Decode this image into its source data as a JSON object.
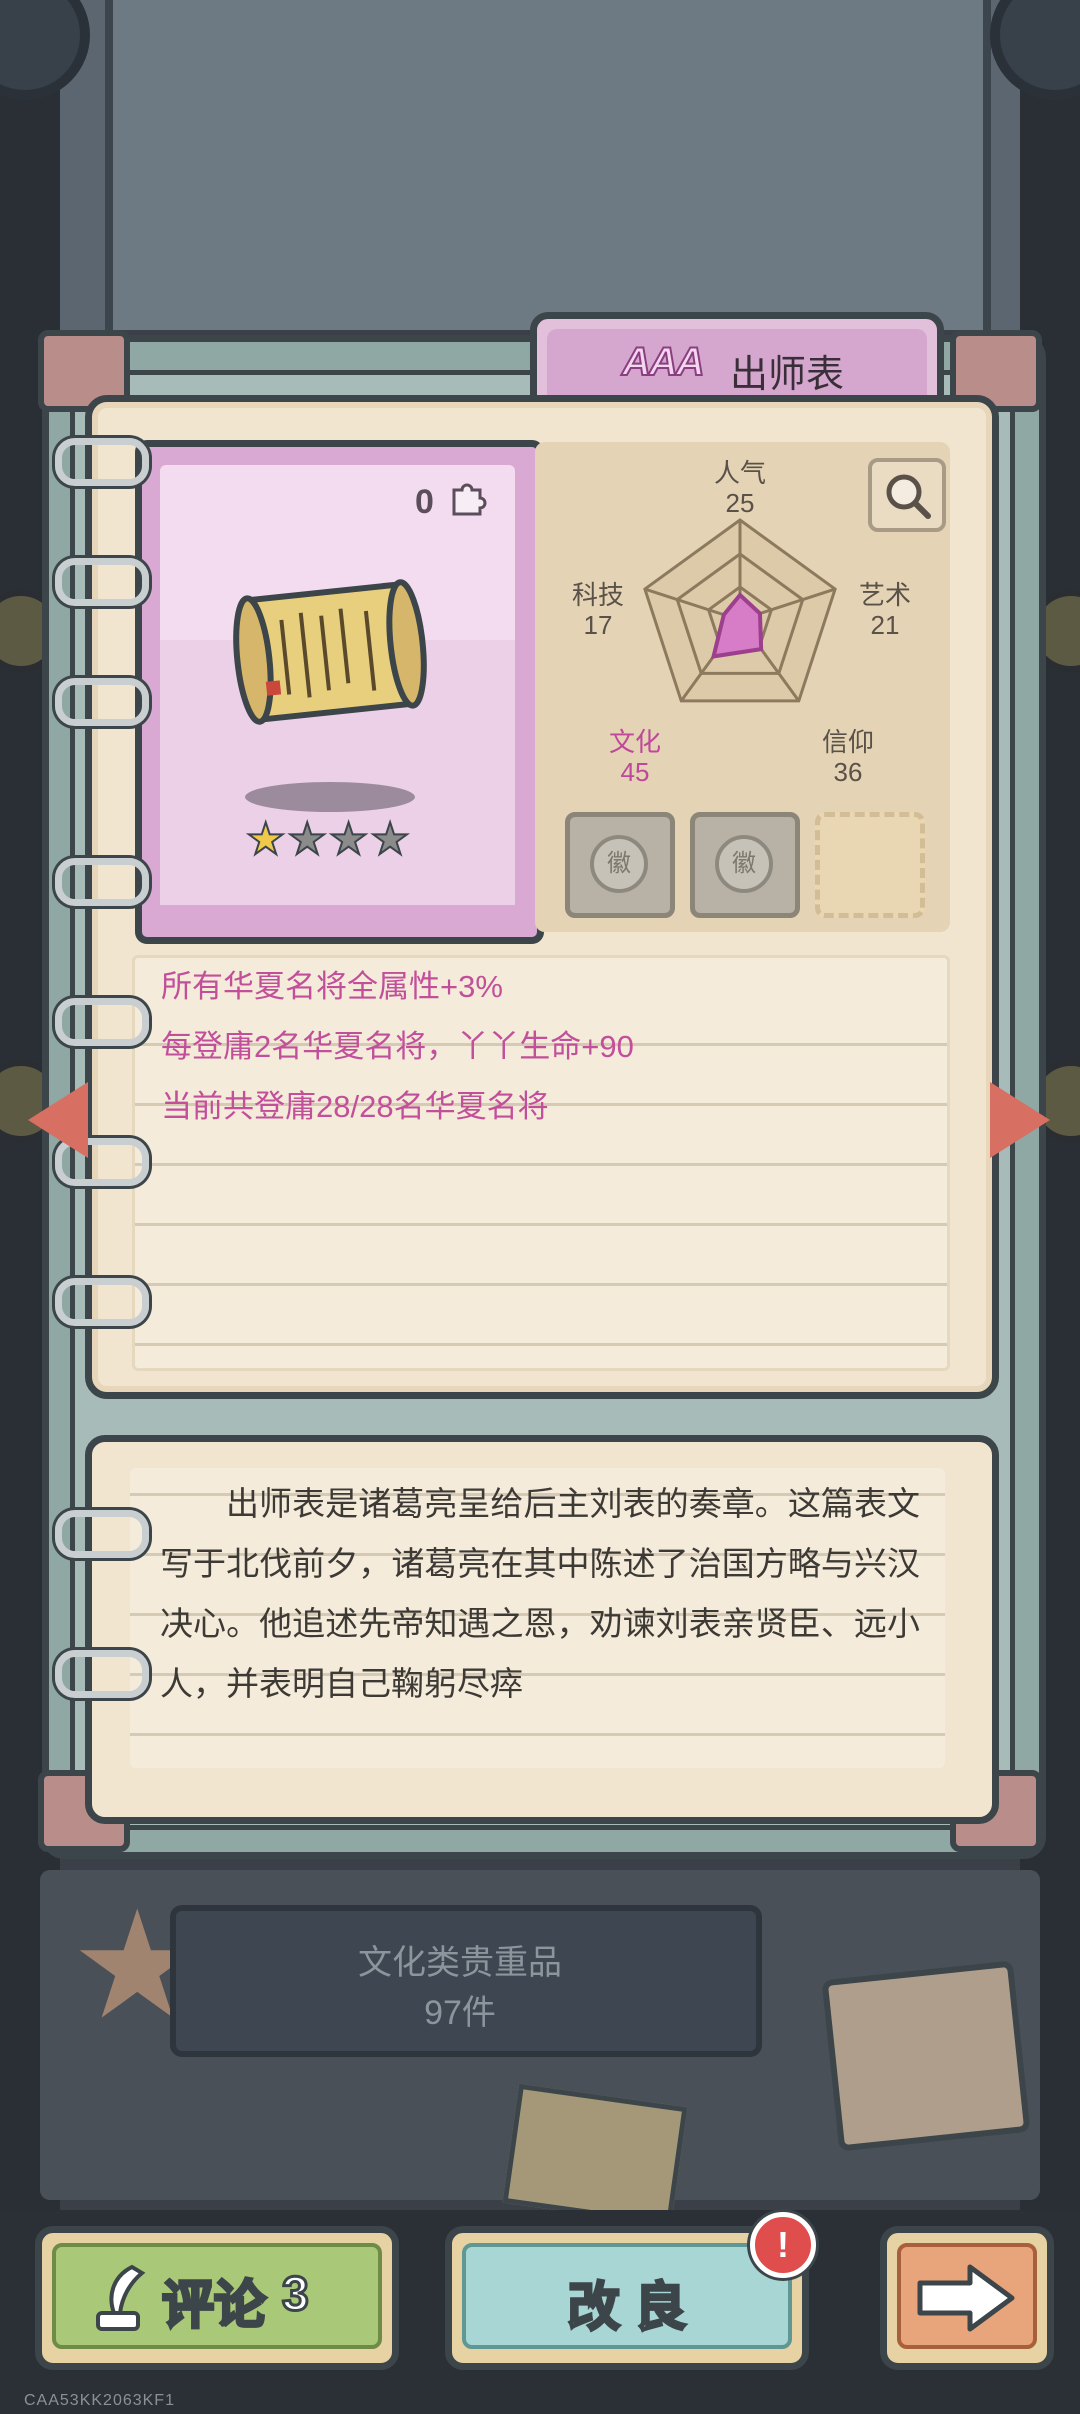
{
  "item": {
    "rank": "AAA",
    "title": "出师表",
    "count": "0",
    "stars_total": 5,
    "stars_filled": 1
  },
  "stats": {
    "popularity": {
      "label": "人气",
      "value": "25"
    },
    "art": {
      "label": "艺术",
      "value": "21"
    },
    "faith": {
      "label": "信仰",
      "value": "36"
    },
    "culture": {
      "label": "文化",
      "value": "45"
    },
    "tech": {
      "label": "科技",
      "value": "17"
    }
  },
  "slots": [
    {
      "state": "filled",
      "icon": "stamp-icon"
    },
    {
      "state": "filled",
      "icon": "stamp-icon"
    },
    {
      "state": "empty",
      "icon": ""
    }
  ],
  "effects": [
    "所有华夏名将全属性+3%",
    "每登庸2名华夏名将，丫丫生命+90",
    "当前共登庸28/28名华夏名将"
  ],
  "description": "出师表是诸葛亮呈给后主刘表的奏章。这篇表文写于北伐前夕，诸葛亮在其中陈述了治国方略与兴汉决心。他追述先帝知遇之恩，劝谏刘表亲贤臣、远小人，并表明自己鞠躬尽瘁",
  "category": {
    "name": "文化类贵重品",
    "count": "97件"
  },
  "buttons": {
    "comment_label": "评论",
    "comment_count": "3",
    "upgrade_label": "改 良",
    "upgrade_alert": "!"
  },
  "device_id": "CAA53KK2063KF1",
  "colors": {
    "accent_pink": "#c24f9a",
    "card_pink": "#d9a9d4",
    "paper": "#f1e5cf",
    "frame_teal": "#8fa8a4"
  }
}
